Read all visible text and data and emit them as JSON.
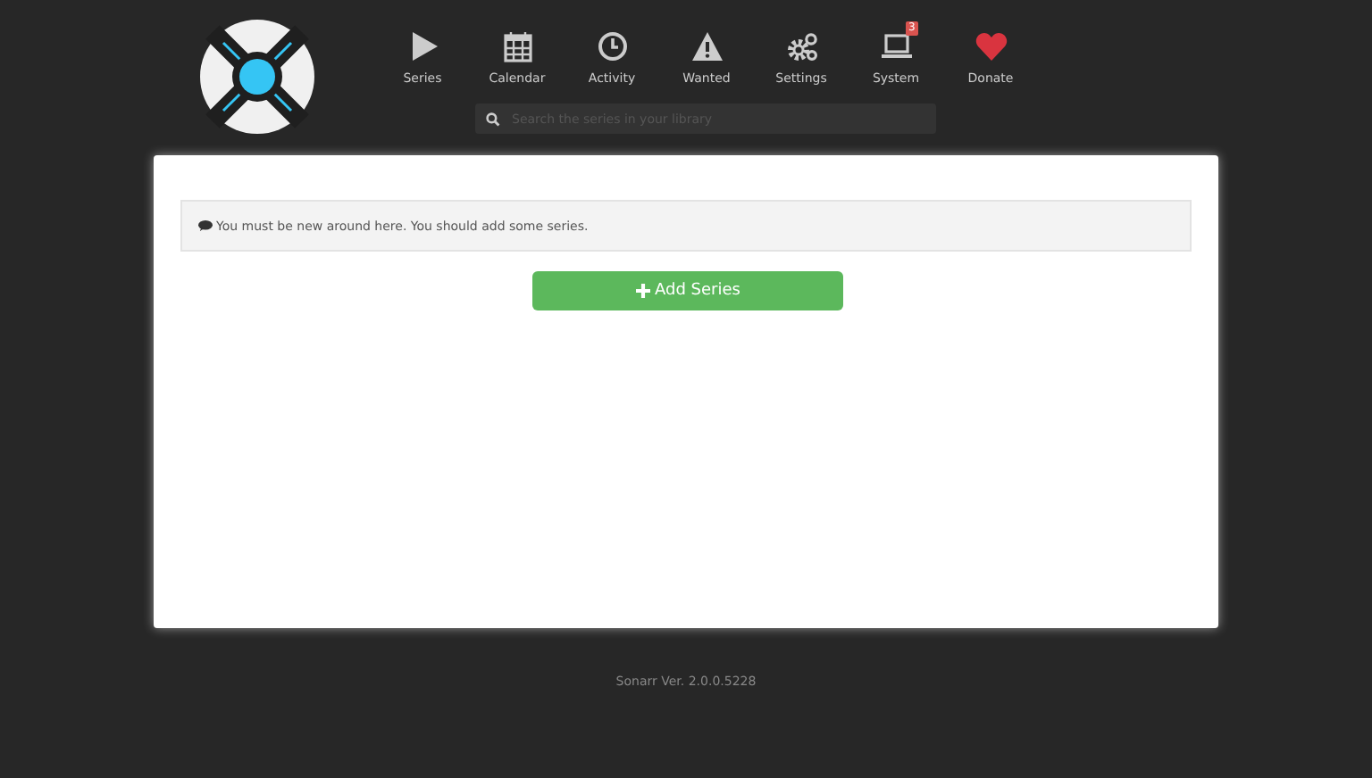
{
  "nav": [
    {
      "label": "Series"
    },
    {
      "label": "Calendar"
    },
    {
      "label": "Activity"
    },
    {
      "label": "Wanted"
    },
    {
      "label": "Settings"
    },
    {
      "label": "System",
      "badge": "3"
    },
    {
      "label": "Donate"
    }
  ],
  "search": {
    "placeholder": "Search the series in your library"
  },
  "alert": {
    "text": "You must be new around here. You should add some series."
  },
  "add_button": {
    "label": "Add Series"
  },
  "footer": {
    "text": "Sonarr Ver. 2.0.0.5228"
  }
}
